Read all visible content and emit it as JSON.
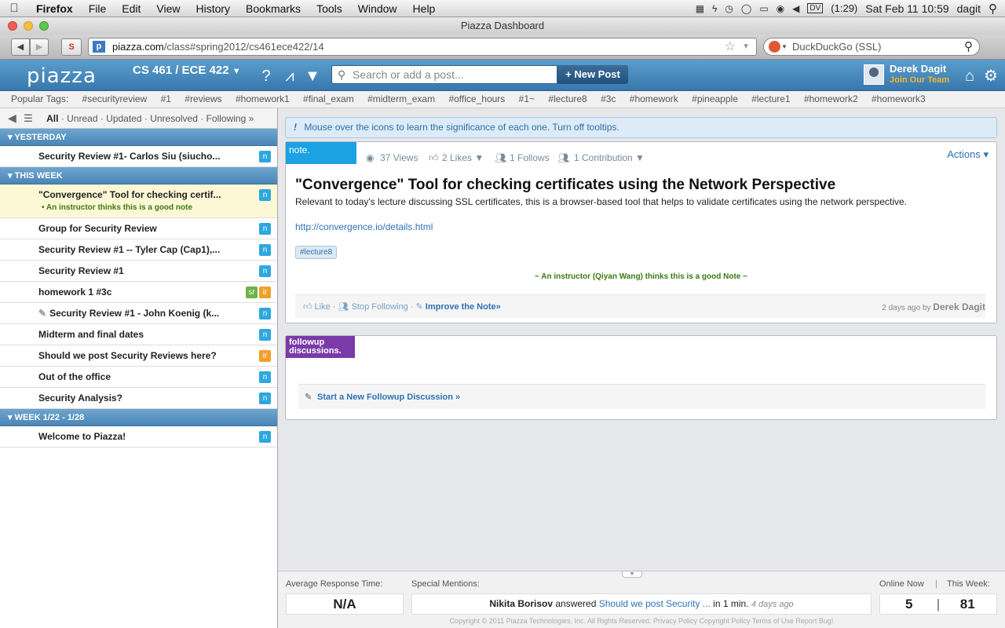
{
  "menubar": {
    "app": "Firefox",
    "items": [
      "File",
      "Edit",
      "View",
      "History",
      "Bookmarks",
      "Tools",
      "Window",
      "Help"
    ],
    "battery": "(1:29)",
    "clock": "Sat Feb 11  10:59",
    "user": "dagit",
    "input_source": "DV"
  },
  "window": {
    "title": "Piazza Dashboard",
    "url_domain": "piazza.com",
    "url_path": "/class#spring2012/cs461ece422/14",
    "search_engine": "DuckDuckGo (SSL)"
  },
  "header": {
    "logo": "piazza",
    "class_name": "CS 461 / ECE 422",
    "search_placeholder": "Search or add a post...",
    "new_post": "+ New Post",
    "user_name": "Derek Dagit",
    "join_team": "Join Our Team"
  },
  "tags": {
    "label": "Popular Tags:",
    "items": [
      "#securityreview",
      "#1",
      "#reviews",
      "#homework1",
      "#final_exam",
      "#midterm_exam",
      "#office_hours",
      "#1~",
      "#lecture8",
      "#3c",
      "#homework",
      "#pineapple",
      "#lecture1",
      "#homework2",
      "#homework3"
    ]
  },
  "filters": {
    "all": "All",
    "rest": "· Unread · Updated · Unresolved · Following »"
  },
  "sidebar": {
    "sections": [
      {
        "label": "YESTERDAY",
        "posts": [
          {
            "title": "Security Review #1- Carlos Siu (siucho...",
            "badges": [
              "n"
            ]
          }
        ]
      },
      {
        "label": "THIS WEEK",
        "posts": [
          {
            "title": "\"Convergence\" Tool for checking certif...",
            "sub": "• An instructor thinks this is a good note",
            "badges": [
              "n"
            ],
            "selected": true
          },
          {
            "title": "Group for Security Review",
            "badges": [
              "n"
            ]
          },
          {
            "title": "Security Review #1 -- Tyler Cap (Cap1),...",
            "badges": [
              "n"
            ]
          },
          {
            "title": "Security Review #1",
            "badges": [
              "n"
            ]
          },
          {
            "title": "homework 1 #3c",
            "badges": [
              "sr",
              "ir"
            ]
          },
          {
            "title": "Security Review #1 - John Koenig (k...",
            "badges": [
              "n"
            ],
            "attachment": true
          },
          {
            "title": "Midterm and final dates",
            "badges": [
              "n"
            ]
          },
          {
            "title": "Should we post Security Reviews here?",
            "badges": [
              "ir"
            ]
          },
          {
            "title": "Out of the office",
            "badges": [
              "n"
            ]
          },
          {
            "title": "Security Analysis?",
            "badges": [
              "n"
            ]
          }
        ]
      },
      {
        "label": "WEEK 1/22 - 1/28",
        "posts": [
          {
            "title": "Welcome to Piazza!",
            "badges": [
              "n"
            ]
          }
        ]
      }
    ]
  },
  "tip": {
    "text": "Mouse over the icons to learn the significance of each one.",
    "link": "Turn off tooltips."
  },
  "note": {
    "label": "note.",
    "views": "37 Views",
    "likes": "2 Likes ▼",
    "follows": "1 Follows",
    "contributions": "1 Contribution ▼",
    "actions": "Actions ▾",
    "title": "\"Convergence\" Tool for checking certificates using the Network Perspective",
    "body": "Relevant to today's lecture discussing SSL certificates, this is a browser-based tool that helps to validate certificates using the network perspective.",
    "link": "http://convergence.io/details.html",
    "tag": "#lecture8",
    "endorsement": "~ An instructor (Qiyan Wang) thinks this is a good Note ~",
    "like": "Like",
    "stop_following": "Stop Following",
    "improve": "Improve the Note»",
    "time": "2 days ago by",
    "author": "Derek Dagit"
  },
  "followup": {
    "label_line1": "followup",
    "label_line2": "discussions.",
    "start": "Start a New Followup Discussion »"
  },
  "stats": {
    "avg_label": "Average Response Time:",
    "avg_value": "N/A",
    "mentions_label": "Special Mentions:",
    "mention_name": "Nikita Borisov",
    "mention_verb": "answered",
    "mention_link": "Should we post Security ...",
    "mention_time": "in 1 min.",
    "mention_ago": "4 days ago",
    "online_label": "Online Now",
    "week_label": "This Week:",
    "online_value": "5",
    "week_value": "81",
    "copyright": "Copyright © 2011 Piazza Technologies, Inc. All Rights Reserved.   Privacy Policy   Copyright Policy   Terms of Use   Report Bug!"
  }
}
